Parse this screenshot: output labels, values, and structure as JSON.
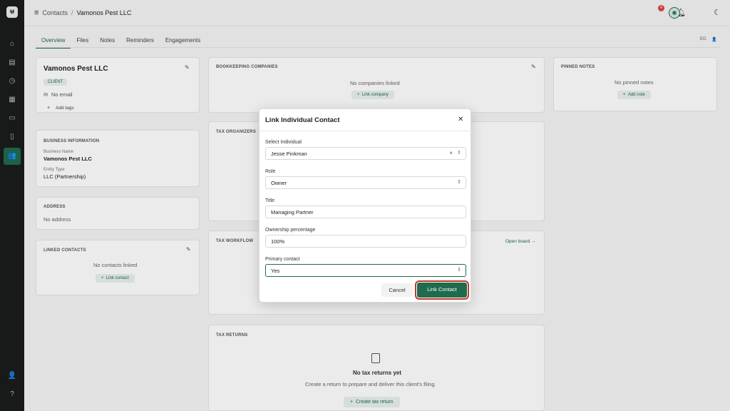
{
  "breadcrumb": {
    "parent": "Contacts",
    "separator": "/",
    "current": "Vamonos Pest LLC"
  },
  "topbar": {
    "notification_count": "4"
  },
  "tabs": [
    "Overview",
    "Files",
    "Notes",
    "Reminders",
    "Engagements"
  ],
  "tab_right": {
    "initials": "EG"
  },
  "client_card": {
    "name": "Vamonos Pest LLC",
    "status": "CLIENT",
    "email": "No email",
    "add_tags": "Add tags"
  },
  "business_info": {
    "heading": "BUSINESS INFORMATION",
    "name_label": "Business Name",
    "name_value": "Vamonos Pest LLC",
    "type_label": "Entity Type",
    "type_value": "LLC (Partnership)"
  },
  "address": {
    "heading": "ADDRESS",
    "value": "No address"
  },
  "linked_contacts": {
    "heading": "LINKED CONTACTS",
    "empty": "No contacts linked",
    "action": "Link contact"
  },
  "bookkeeping": {
    "heading": "BOOKKEEPING COMPANIES",
    "empty": "No companies linked",
    "action": "Link company"
  },
  "pinned_notes": {
    "heading": "PINNED NOTES",
    "empty": "No pinned notes",
    "action": "Add note"
  },
  "tax_organizers": {
    "heading": "TAX ORGANIZERS"
  },
  "tax_workflow": {
    "heading": "TAX WORKFLOW",
    "action": "Open board"
  },
  "tax_returns": {
    "heading": "TAX RETURNS",
    "empty_title": "No tax returns yet",
    "empty_desc": "Create a return to prepare and deliver this client's filing.",
    "action": "Create tax return"
  },
  "modal": {
    "title": "Link Individual Contact",
    "individual_label": "Select Individual",
    "individual_value": "Jesse Pinkman",
    "role_label": "Role",
    "role_value": "Owner",
    "title_label": "Title",
    "title_value": "Managing Partner",
    "ownership_label": "Ownership percentage",
    "ownership_value": "100%",
    "primary_label": "Primary contact",
    "primary_value": "Yes",
    "cancel": "Cancel",
    "submit": "Link Contact"
  },
  "colors": {
    "accent": "#1f6b4c",
    "rail": "#1b1d1c",
    "badge": "#d9463e",
    "focus_ring": "#c0392b"
  }
}
